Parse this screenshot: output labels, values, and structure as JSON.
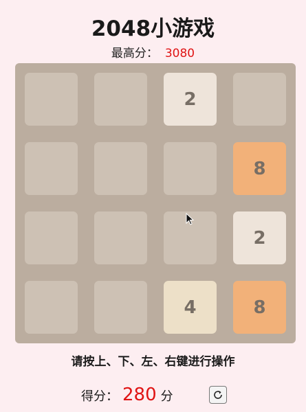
{
  "title": "2048小游戏",
  "best": {
    "label": "最高分：",
    "value": "3080"
  },
  "grid": [
    [
      "",
      "",
      "2",
      ""
    ],
    [
      "",
      "",
      "",
      "8"
    ],
    [
      "",
      "",
      "",
      "2"
    ],
    [
      "",
      "",
      "4",
      "8"
    ]
  ],
  "tile_colors": {
    "empty": "#cdc1b4",
    "2": "#eee4da",
    "4": "#ede0c8",
    "8": "#f2b179"
  },
  "hint": "请按上、下、左、右键进行操作",
  "score": {
    "label": "得分：",
    "value": "280",
    "unit": "分"
  },
  "restart_icon": "refresh-icon"
}
